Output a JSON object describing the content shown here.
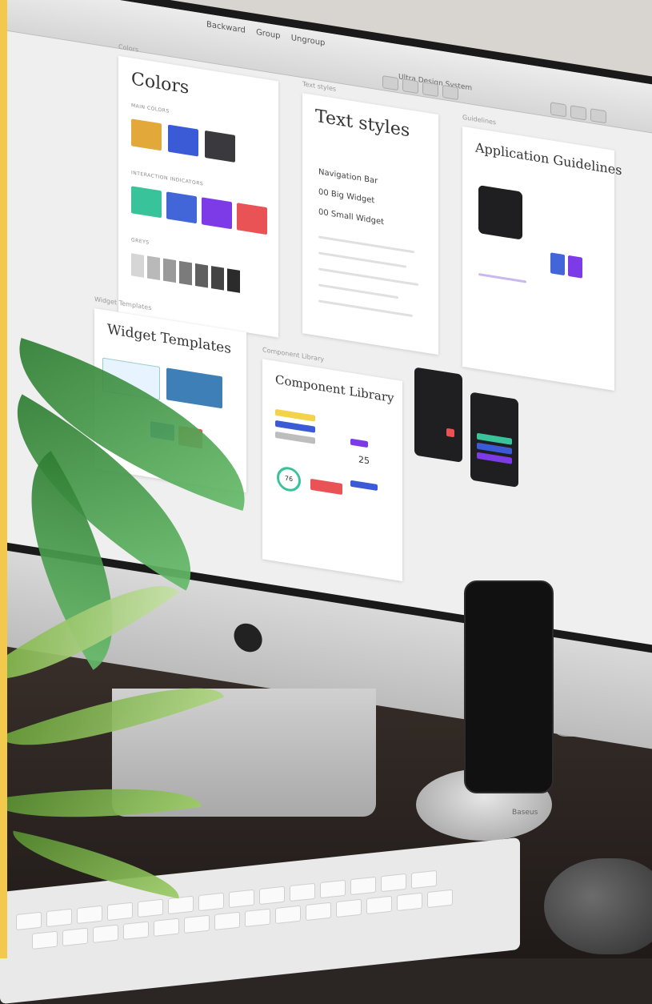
{
  "screen": {
    "toolbar": {
      "menu": [
        "Backward",
        "Group",
        "Ungroup"
      ],
      "doc_title": "Ultra Design System"
    },
    "colors": {
      "tag": "Colors",
      "title": "Colors",
      "main_label": "MAIN COLORS",
      "interaction_label": "INTERACTION INDICATORS",
      "greys_label": "GREYS",
      "main_swatches": [
        "#e3a83a",
        "#3b5bd6",
        "#3a3a3e"
      ],
      "interaction_swatches": [
        "#39c39a",
        "#4265d8",
        "#7c3be6",
        "#ea5355"
      ],
      "greys": [
        "#d6d6d6",
        "#b9b9b9",
        "#9a9a9a",
        "#7b7b7b",
        "#5f5f5f",
        "#444444",
        "#2b2b2b"
      ]
    },
    "text_styles": {
      "tag": "Text styles",
      "title": "Text styles",
      "rows": [
        "Navigation Bar",
        "00 Big Widget",
        "00 Small Widget"
      ]
    },
    "guidelines": {
      "tag": "Guidelines",
      "title": "Application Guidelines"
    },
    "widgets": {
      "tag": "Widget Templates",
      "title": "Widget Templates"
    },
    "components": {
      "tag": "Component Library",
      "title": "Component Library",
      "stepper_value": "25",
      "gauge_value": "76"
    }
  },
  "hardware": {
    "apple_logo": "apple-logo",
    "dock_brand": "Baseus"
  }
}
